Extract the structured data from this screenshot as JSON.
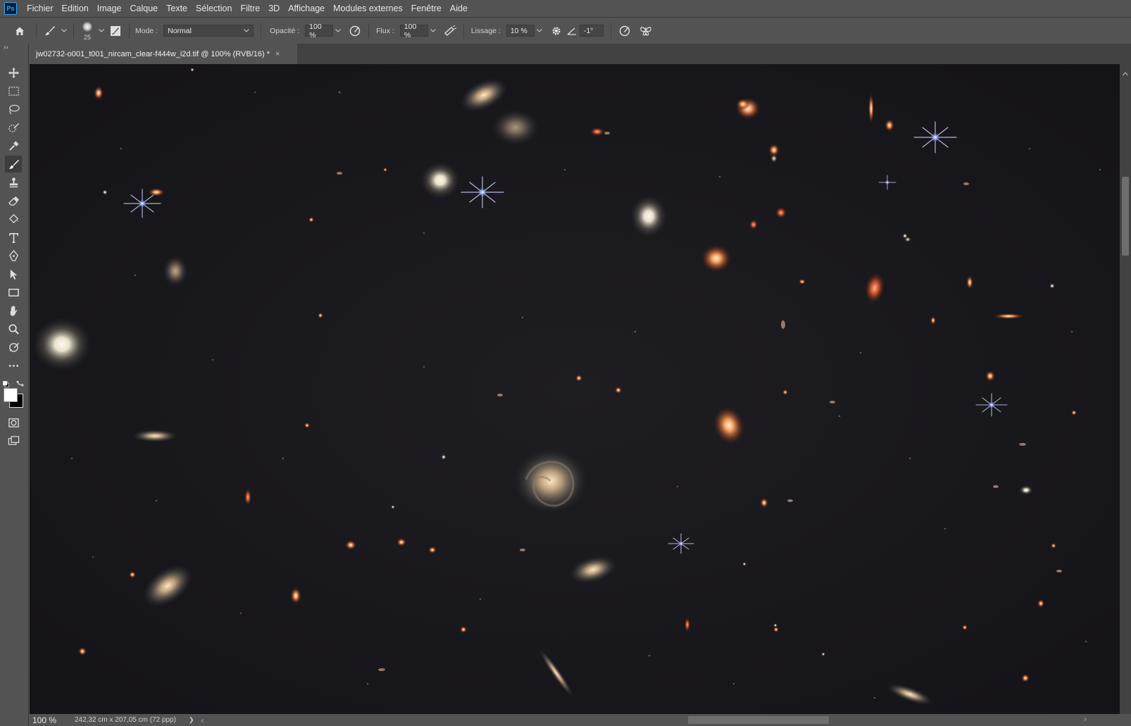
{
  "app": {
    "logo": "Ps"
  },
  "menu": [
    "Fichier",
    "Edition",
    "Image",
    "Calque",
    "Texte",
    "Sélection",
    "Filtre",
    "3D",
    "Affichage",
    "Modules externes",
    "Fenêtre",
    "Aide"
  ],
  "options": {
    "brush_size": "25",
    "mode_label": "Mode :",
    "mode_value": "Normal",
    "opacity_label": "Opacité :",
    "opacity_value": "100 %",
    "flow_label": "Flux :",
    "flow_value": "100 %",
    "smoothing_label": "Lissage :",
    "smoothing_value": "10 %",
    "angle_value": "-1°"
  },
  "document": {
    "tab_title": "jw02732-o001_t001_nircam_clear-f444w_i2d.tif @ 100% (RVB/16) *",
    "close_glyph": "×"
  },
  "status": {
    "zoom": "100 %",
    "doc_info": "242,32 cm x 207,05 cm (72 ppp)",
    "arrow": "❯",
    "scroll_left": "‹",
    "scroll_right": "›"
  },
  "toolbar": {
    "expand": "››",
    "tools": [
      {
        "name": "move-tool-icon",
        "active": false
      },
      {
        "name": "marquee-tool-icon",
        "active": false
      },
      {
        "name": "lasso-tool-icon",
        "active": false
      },
      {
        "name": "quick-selection-tool-icon",
        "active": false
      },
      {
        "name": "eyedropper-tool-icon",
        "active": false
      },
      {
        "name": "brush-tool-icon",
        "active": true
      },
      {
        "name": "clone-stamp-tool-icon",
        "active": false
      },
      {
        "name": "eraser-tool-icon",
        "active": false
      },
      {
        "name": "paint-bucket-tool-icon",
        "active": false
      },
      {
        "name": "type-tool-icon",
        "active": false
      },
      {
        "name": "pen-tool-icon",
        "active": false
      },
      {
        "name": "path-selection-tool-icon",
        "active": false
      },
      {
        "name": "rectangle-tool-icon",
        "active": false
      },
      {
        "name": "hand-tool-icon",
        "active": false
      },
      {
        "name": "zoom-tool-icon",
        "active": false
      },
      {
        "name": "edit-toolbar-icon",
        "active": false
      },
      {
        "name": "more-tools-icon",
        "active": false
      }
    ]
  },
  "colors": {
    "ui_bg": "#535353",
    "canvas_bg": "#17161b",
    "accent": "#31a8ff",
    "foreground_swatch": "#ffffff",
    "background_swatch": "#000000"
  }
}
